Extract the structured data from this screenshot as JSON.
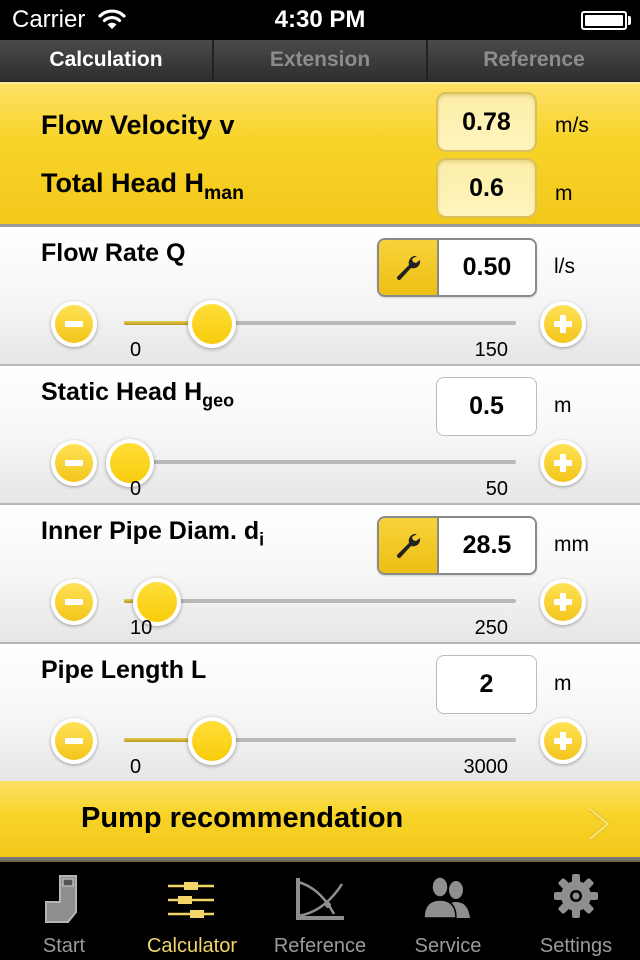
{
  "status_bar": {
    "carrier": "Carrier",
    "time": "4:30 PM",
    "battery_level": 1.0
  },
  "segments": [
    {
      "label": "Calculation",
      "active": true
    },
    {
      "label": "Extension",
      "active": false
    },
    {
      "label": "Reference",
      "active": false
    }
  ],
  "results": {
    "flow_velocity": {
      "label": "Flow Velocity v",
      "value": "0.78",
      "unit": "m/s"
    },
    "total_head": {
      "label": "Total Head H",
      "sub": "man",
      "value": "0.6",
      "unit": "m"
    }
  },
  "inputs": [
    {
      "id": "flow-rate",
      "label": "Flow Rate Q",
      "sub": "",
      "value": "0.50",
      "unit": "l/s",
      "has_wrench": true,
      "min": "0",
      "max": "150",
      "slider_fraction": 0.22
    },
    {
      "id": "static-head",
      "label": "Static Head H",
      "sub": "geo",
      "value": "0.5",
      "unit": "m",
      "has_wrench": false,
      "min": "0",
      "max": "50",
      "slider_fraction": 0.01
    },
    {
      "id": "inner-pipe-diam",
      "label": "Inner Pipe Diam. d",
      "sub": "i",
      "value": "28.5",
      "unit": "mm",
      "has_wrench": true,
      "min": "10",
      "max": "250",
      "slider_fraction": 0.08
    },
    {
      "id": "pipe-length",
      "label": "Pipe Length L",
      "sub": "",
      "value": "2",
      "unit": "m",
      "has_wrench": false,
      "min": "0",
      "max": "3000",
      "slider_fraction": 0.22
    }
  ],
  "pump_recommendation": {
    "label": "Pump recommendation"
  },
  "tabbar": [
    {
      "label": "Start",
      "icon": "pipe-bend-icon",
      "active": false
    },
    {
      "label": "Calculator",
      "icon": "sliders-icon",
      "active": true
    },
    {
      "label": "Reference",
      "icon": "curve-chart-icon",
      "active": false
    },
    {
      "label": "Service",
      "icon": "people-icon",
      "active": false
    },
    {
      "label": "Settings",
      "icon": "gear-icon",
      "active": false
    }
  ],
  "colors": {
    "accent_yellow": "#f8d428",
    "tab_active": "#f3d46b",
    "tab_inactive": "#9a9a9a"
  }
}
